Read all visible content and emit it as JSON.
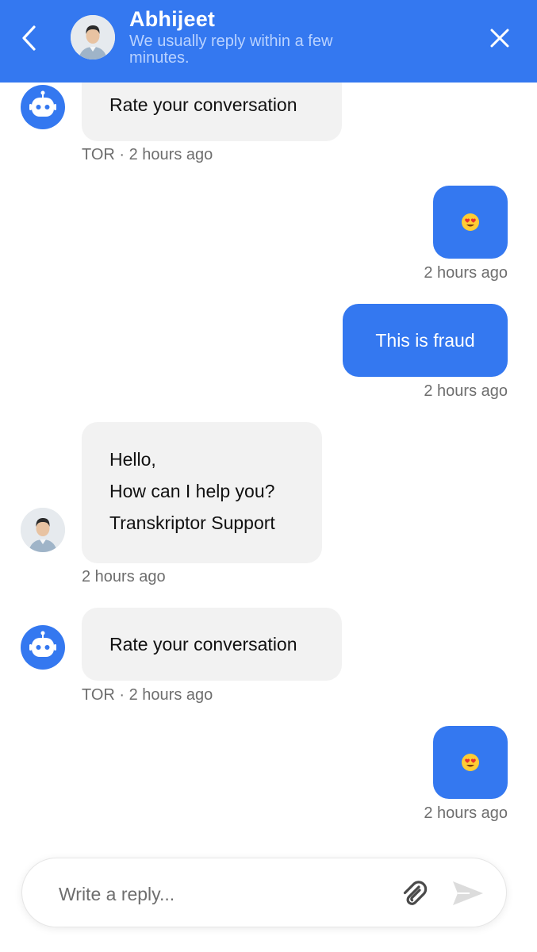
{
  "header": {
    "name": "Abhijeet",
    "subtitle": "We usually reply within a few minutes.",
    "back_icon": "chevron-left-icon",
    "close_icon": "close-icon",
    "background_color": "#3478f0"
  },
  "messages": [
    {
      "from": "bot",
      "text": "Rate your conversation",
      "meta": "TOR · 2 hours ago"
    },
    {
      "from": "user",
      "emoji": "heart-eyes-emoji",
      "meta": "2 hours ago"
    },
    {
      "from": "user",
      "text": "This is fraud",
      "meta": "2 hours ago"
    },
    {
      "from": "agent",
      "lines": [
        "Hello,",
        "How can I help you?",
        "Transkriptor Support"
      ],
      "meta": "2 hours ago"
    },
    {
      "from": "bot",
      "text": "Rate your conversation",
      "meta": "TOR · 2 hours ago"
    },
    {
      "from": "user",
      "emoji": "heart-eyes-emoji",
      "meta": "2 hours ago"
    }
  ],
  "composer": {
    "placeholder": "Write a reply...",
    "value": "",
    "attach_icon": "paperclip-icon",
    "send_icon": "send-icon"
  },
  "colors": {
    "accent": "#3478f0",
    "incoming_bubble": "#f2f2f2",
    "meta_text": "#6e6e6e"
  }
}
